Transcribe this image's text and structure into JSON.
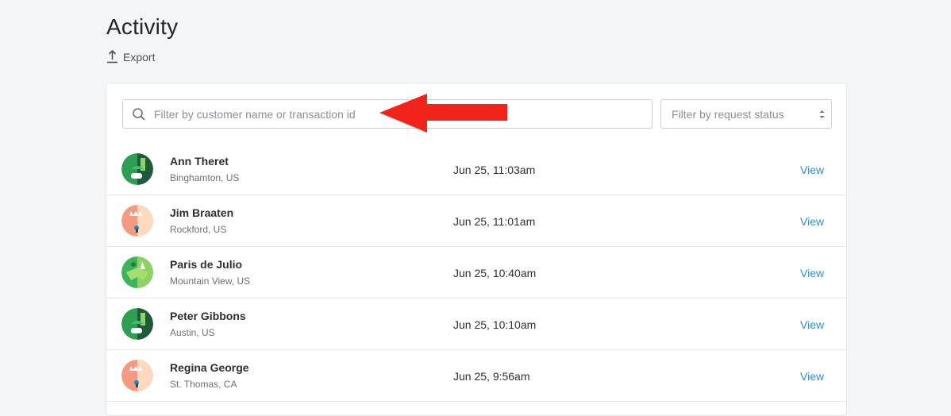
{
  "page": {
    "title": "Activity",
    "export_label": "Export"
  },
  "filters": {
    "search_placeholder": "Filter by customer name or transaction id",
    "status_placeholder": "Filter by request status"
  },
  "colors": {
    "link": "#2c8ed6",
    "annotation_arrow": "#f2231a"
  },
  "rows": [
    {
      "name": "Ann Theret",
      "location": "Binghamton, US",
      "time": "Jun 25, 11:03am",
      "action": "View",
      "avatar": "green-dark"
    },
    {
      "name": "Jim Braaten",
      "location": "Rockford, US",
      "time": "Jun 25, 11:01am",
      "action": "View",
      "avatar": "peach"
    },
    {
      "name": "Paris de Julio",
      "location": "Mountain View, US",
      "time": "Jun 25, 10:40am",
      "action": "View",
      "avatar": "green-light"
    },
    {
      "name": "Peter Gibbons",
      "location": "Austin, US",
      "time": "Jun 25, 10:10am",
      "action": "View",
      "avatar": "green-dark"
    },
    {
      "name": "Regina George",
      "location": "St. Thomas, CA",
      "time": "Jun 25, 9:56am",
      "action": "View",
      "avatar": "peach"
    }
  ]
}
